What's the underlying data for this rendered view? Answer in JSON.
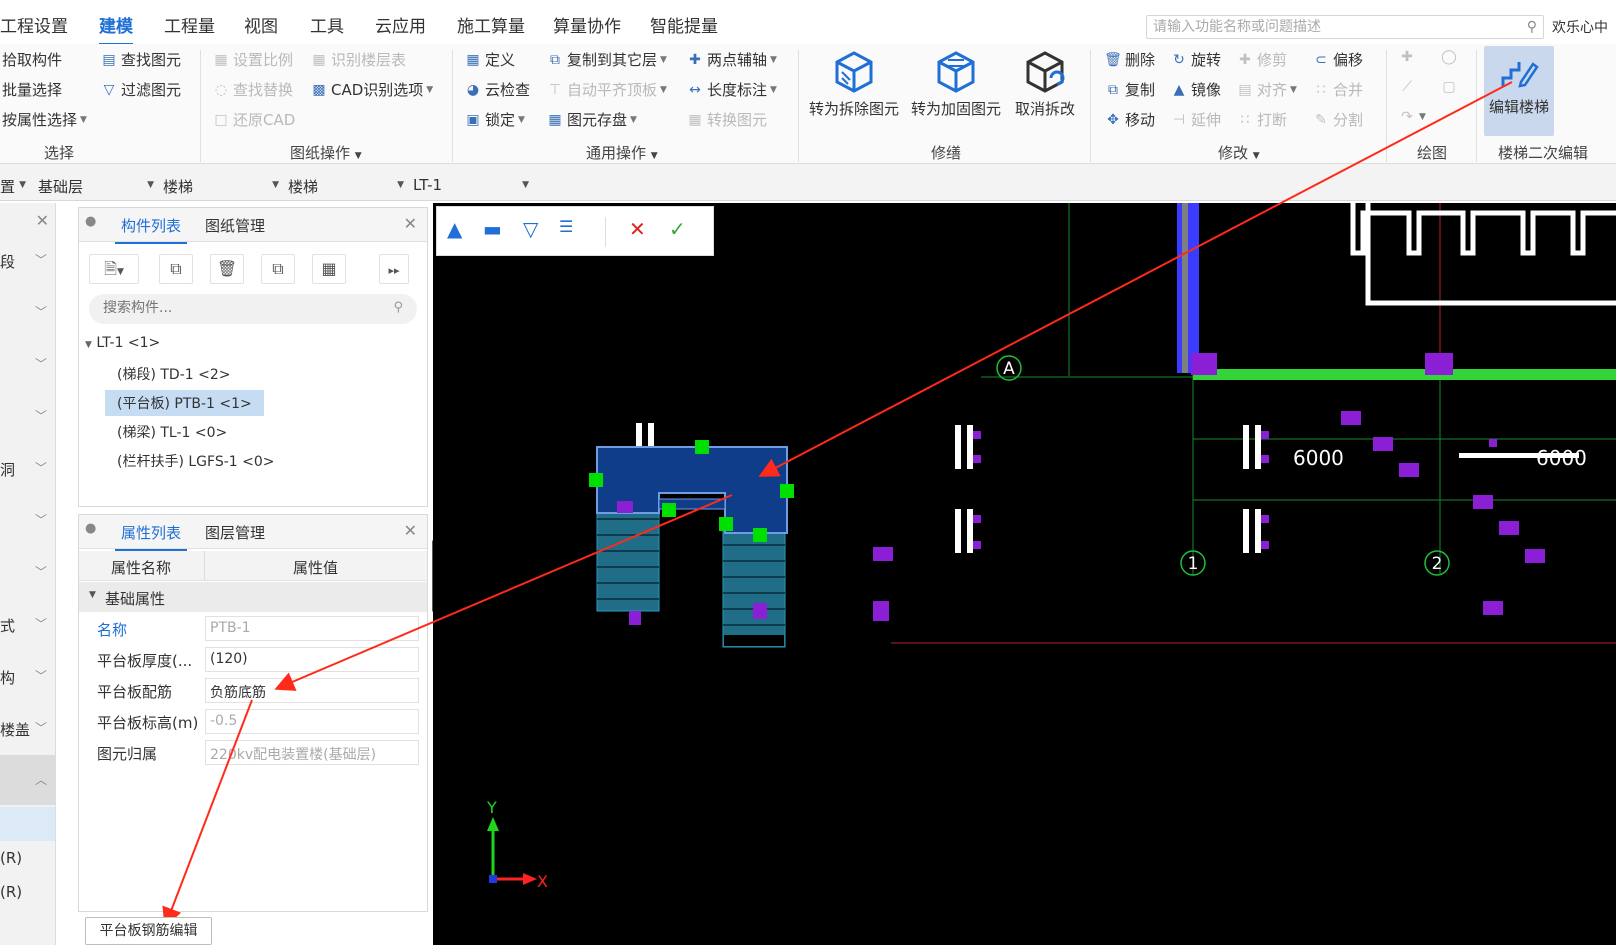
{
  "menu": [
    "工程设置",
    "建模",
    "工程量",
    "视图",
    "工具",
    "云应用",
    "施工算量",
    "算量协作",
    "智能提量"
  ],
  "search_placeholder": "请输入功能名称或问题描述",
  "welcome": "欢乐心中",
  "ribbon": {
    "select": {
      "items": [
        "拾取构件",
        "批量选择",
        "按属性选择"
      ],
      "items2": [
        "查找图元",
        "过滤图元"
      ],
      "group": "选择"
    },
    "drawing": {
      "items": [
        "设置比例",
        "查找替换",
        "还原CAD"
      ],
      "items2": [
        "识别楼层表",
        "CAD识别选项"
      ],
      "group": "图纸操作"
    },
    "common": {
      "items": [
        "定义",
        "云检查",
        "锁定"
      ],
      "items2": [
        "复制到其它层",
        "自动平齐顶板",
        "图元存盘"
      ],
      "items3": [
        "两点辅轴",
        "长度标注",
        "转换图元"
      ],
      "group": "通用操作"
    },
    "repair": {
      "b1": "转为拆除图元",
      "b2": "转为加固图元",
      "b3": "取消拆改",
      "group": "修缮"
    },
    "modify": {
      "items": [
        "删除",
        "复制",
        "移动"
      ],
      "items2": [
        "旋转",
        "镜像",
        "延伸"
      ],
      "items3": [
        "修剪",
        "对齐",
        "打断"
      ],
      "items4": [
        "偏移",
        "合并",
        "分割"
      ],
      "group": "修改"
    },
    "draw": {
      "group": "绘图"
    },
    "stair2": {
      "button": "编辑楼梯",
      "group": "楼梯二次编辑"
    }
  },
  "selectors": [
    "置",
    "基础层",
    "楼梯",
    "楼梯",
    "LT-1"
  ],
  "leftnav": [
    "段",
    "",
    "",
    "",
    "洞",
    "",
    "",
    "式",
    "构",
    "楼盖",
    "",
    "",
    "(R)",
    "(R)"
  ],
  "comp_panel": {
    "tabs": [
      "构件列表",
      "图纸管理"
    ],
    "search_placeholder": "搜索构件...",
    "tree": [
      "LT-1 <1>",
      "(梯段) TD-1 <2>",
      "(平台板) PTB-1 <1>",
      "(梯梁) TL-1 <0>",
      "(栏杆扶手) LGFS-1 <0>"
    ]
  },
  "prop_panel": {
    "tabs": [
      "属性列表",
      "图层管理"
    ],
    "headers": [
      "属性名称",
      "属性值"
    ],
    "group": "基础属性",
    "rows": [
      {
        "k": "名称",
        "v": "PTB-1"
      },
      {
        "k": "平台板厚度(...",
        "v": "(120)"
      },
      {
        "k": "平台板配筋",
        "v": "负筋底筋"
      },
      {
        "k": "平台板标高(m)",
        "v": "-0.5"
      },
      {
        "k": "图元归属",
        "v": "220kv配电装置楼(基础层)"
      }
    ]
  },
  "bottom_button": "平台板钢筋编辑",
  "canvas": {
    "axis_a": "A",
    "axis_1": "1",
    "axis_2": "2",
    "dim1": "6000",
    "dim2": "6000",
    "x_label": "X",
    "y_label": "Y"
  },
  "colors": {
    "accent": "#1f6fd6",
    "stair_fill": "#0f3d8a",
    "flight_fill": "#1f6d86",
    "grip": "#00e000",
    "purple": "#8a1fd6",
    "beam_green": "#33d33a",
    "arrow": "#ff2a1a"
  }
}
